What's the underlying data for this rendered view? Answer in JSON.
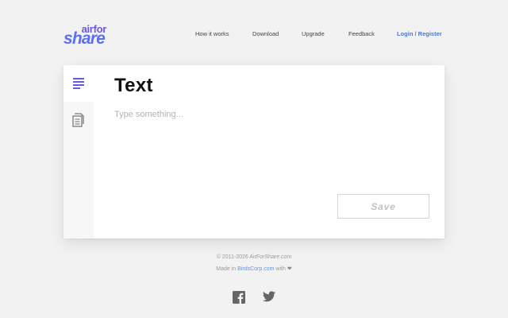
{
  "header": {
    "logo": {
      "top": "airfor",
      "bottom": "share"
    },
    "nav": [
      {
        "label": "How it works"
      },
      {
        "label": "Download"
      },
      {
        "label": "Upgrade"
      },
      {
        "label": "Feedback"
      },
      {
        "label": "Login / Register"
      }
    ]
  },
  "card": {
    "title": "Text",
    "sidebar": [
      {
        "icon": "text-lines-icon",
        "active": true
      },
      {
        "icon": "document-icon",
        "active": false
      }
    ],
    "input": {
      "placeholder": "Type something...",
      "value": ""
    },
    "save_label": "Save"
  },
  "footer": {
    "copyright": "© 2011-2026 AirForShare.com",
    "made_in_prefix": "Made in",
    "made_in_link": "BirdsCorp.com",
    "made_in_suffix": "with",
    "heart": "❤",
    "social": [
      {
        "icon": "facebook-icon"
      },
      {
        "icon": "twitter-icon"
      }
    ]
  },
  "colors": {
    "background": "#f2f2f2",
    "brand_purple": "#6a5adf",
    "brand_blue": "#5b6ff0",
    "link": "#4a78d6"
  }
}
